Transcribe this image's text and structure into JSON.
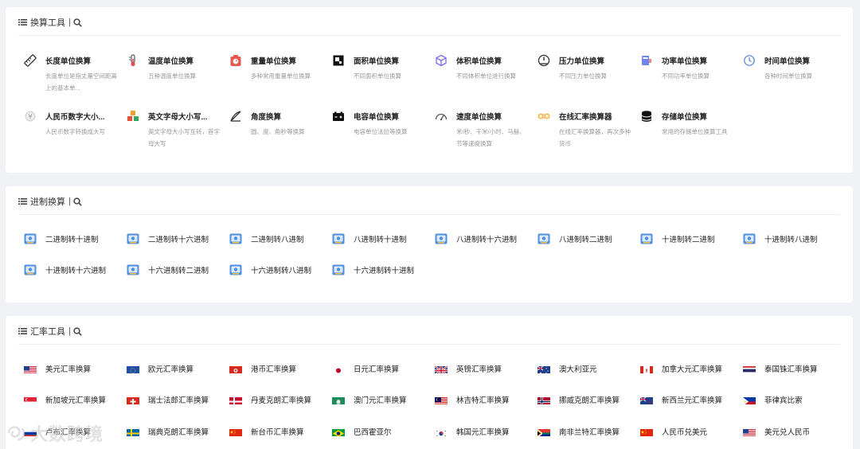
{
  "sections": {
    "unit": {
      "title": "换算工具"
    },
    "base": {
      "title": "进制换算"
    },
    "rate": {
      "title": "汇率工具"
    }
  },
  "unit_tools": [
    {
      "title": "长度单位换算",
      "desc": "长度单位是指丈量空间距离上的基本单...",
      "icon": "ruler-icon"
    },
    {
      "title": "温度单位换算",
      "desc": "五种温度单位换算",
      "icon": "thermometer-icon"
    },
    {
      "title": "重量单位换算",
      "desc": "多种常用重量单位换算",
      "icon": "scale-icon"
    },
    {
      "title": "面积单位换算",
      "desc": "不同面积单位换算",
      "icon": "area-icon"
    },
    {
      "title": "体积单位换算",
      "desc": "不同体积单位进行换算",
      "icon": "cube-icon"
    },
    {
      "title": "压力单位换算",
      "desc": "不同压力单位换算",
      "icon": "pressure-icon"
    },
    {
      "title": "功率单位换算",
      "desc": "不同功率单位换算",
      "icon": "power-icon"
    },
    {
      "title": "时间单位换算",
      "desc": "各种时间单位换算",
      "icon": "clock-icon"
    },
    {
      "title": "人民币数字大小...",
      "desc": "人民币数字转换成大写",
      "icon": "rmb-icon"
    },
    {
      "title": "英文字母大小写...",
      "desc": "英文字母大小写互转，首字母大写",
      "icon": "letters-icon"
    },
    {
      "title": "角度换算",
      "desc": "圆、度、角秒等换算",
      "icon": "angle-icon"
    },
    {
      "title": "电容单位换算",
      "desc": "电容单位法拉等换算",
      "icon": "battery-icon"
    },
    {
      "title": "速度单位换算",
      "desc": "米/秒、千米/小时、马赫、节等速度换算",
      "icon": "speedometer-icon"
    },
    {
      "title": "在线汇率换算器",
      "desc": "在线汇率换算器，再次多种货币",
      "icon": "coins-icon"
    },
    {
      "title": "存储单位换算",
      "desc": "常用的存储单位换算工具",
      "icon": "database-icon"
    }
  ],
  "base_tools": [
    "二进制转十进制",
    "二进制转十六进制",
    "二进制转八进制",
    "八进制转十进制",
    "八进制转十六进制",
    "八进制转二进制",
    "十进制转二进制",
    "十进制转八进制",
    "十进制转十六进制",
    "十六进制转二进制",
    "十六进制转八进制",
    "十六进制转十进制"
  ],
  "rate_tools": [
    {
      "label": "美元汇率换算",
      "flag": "us"
    },
    {
      "label": "欧元汇率换算",
      "flag": "eu"
    },
    {
      "label": "港币汇率换算",
      "flag": "hk"
    },
    {
      "label": "日元汇率换算",
      "flag": "jp"
    },
    {
      "label": "英镑汇率换算",
      "flag": "gb"
    },
    {
      "label": "澳大利亚元",
      "flag": "au"
    },
    {
      "label": "加拿大元汇率换算",
      "flag": "ca"
    },
    {
      "label": "泰国铢汇率换算",
      "flag": "th"
    },
    {
      "label": "新加坡元汇率换算",
      "flag": "sg"
    },
    {
      "label": "瑞士法郎汇率换算",
      "flag": "ch"
    },
    {
      "label": "丹麦克朗汇率换算",
      "flag": "dk"
    },
    {
      "label": "澳门元汇率换算",
      "flag": "mo"
    },
    {
      "label": "林吉特汇率换算",
      "flag": "my"
    },
    {
      "label": "挪威克朗汇率换算",
      "flag": "no"
    },
    {
      "label": "新西兰元汇率换算",
      "flag": "nz"
    },
    {
      "label": "菲律宾比索",
      "flag": "ph"
    },
    {
      "label": "卢布汇率换算",
      "flag": "ru"
    },
    {
      "label": "瑞典克朗汇率换算",
      "flag": "se"
    },
    {
      "label": "新台币汇率换算",
      "flag": "cn"
    },
    {
      "label": "巴西霍亚尔",
      "flag": "br"
    },
    {
      "label": "韩国元汇率换算",
      "flag": "kr"
    },
    {
      "label": "南非兰特汇率换算",
      "flag": "za"
    },
    {
      "label": "人民币兑美元",
      "flag": "cn"
    },
    {
      "label": "美元兑人民币",
      "flag": "us"
    }
  ],
  "watermark": "大数跨境",
  "colors": {
    "background": "#f1f2f6",
    "card": "#ffffff",
    "desc": "#999999"
  }
}
